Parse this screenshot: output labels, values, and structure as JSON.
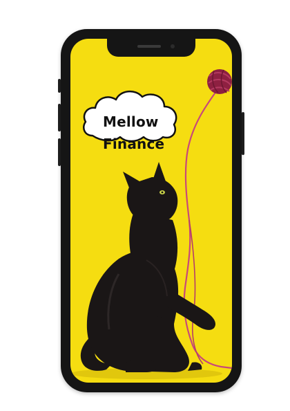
{
  "brand": {
    "line1": "Mellow",
    "line2": "Finance"
  },
  "colors": {
    "background": "#f5dd11",
    "device": "#151515",
    "yarn": "#9b2447",
    "yarn_thread": "#c8487a",
    "cat": "#1a1616"
  },
  "icons": {
    "logo_shape": "cloud-icon",
    "yarn_ball": "yarn-ball-icon"
  }
}
